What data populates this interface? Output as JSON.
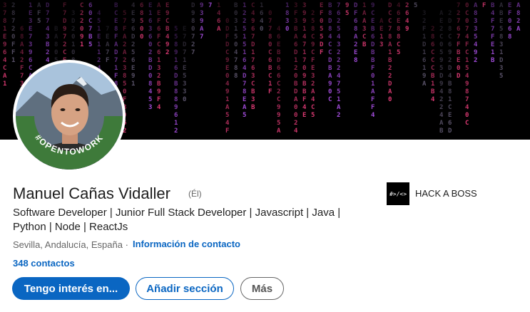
{
  "profile": {
    "name": "Manuel Cañas Vidaller",
    "pronoun_badge": "(Él)",
    "headline": "Software Developer | Junior Full Stack Developer | Javascript | Java | Python | Node | ReactJs",
    "location": "Sevilla, Andalucía, España",
    "separator": "·",
    "contact_info_link": "Información de contacto",
    "connections": "348 contactos",
    "open_to_work_badge": "#OPENTOWORK"
  },
  "company": {
    "logo_text": "#>/<>",
    "name": "HACK A BOSS"
  },
  "actions": {
    "primary": "Tengo interés en...",
    "add_section": "Añadir sección",
    "more": "Más"
  },
  "colors": {
    "accent": "#0a66c2",
    "banner_bg": "#000000",
    "open_to_work_green": "#3e7a3a"
  }
}
